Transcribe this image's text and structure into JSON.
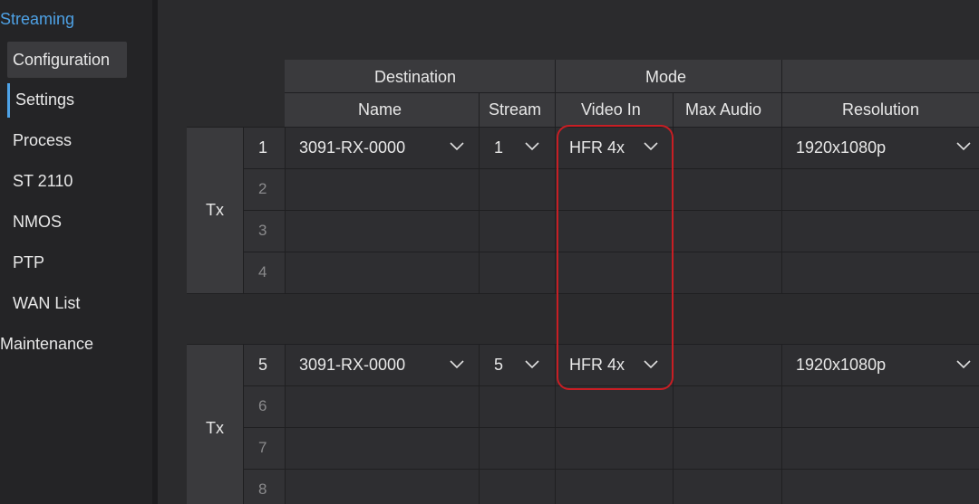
{
  "sidebar": {
    "streaming": "Streaming",
    "configuration": "Configuration",
    "settings": "Settings",
    "process": "Process",
    "st2110": "ST 2110",
    "nmos": "NMOS",
    "ptp": "PTP",
    "wan_list": "WAN List",
    "maintenance": "Maintenance"
  },
  "table": {
    "group_headers": {
      "destination": "Destination",
      "mode": "Mode"
    },
    "columns": {
      "name": "Name",
      "stream": "Stream",
      "video_in": "Video In",
      "max_audio": "Max Audio",
      "resolution": "Resolution"
    },
    "blocks": [
      {
        "label": "Tx",
        "rows": [
          {
            "index": "1",
            "name": "3091-RX-0000",
            "stream": "1",
            "video_in": "HFR 4x",
            "max_audio": "",
            "resolution": "1920x1080p"
          },
          {
            "index": "2"
          },
          {
            "index": "3"
          },
          {
            "index": "4"
          }
        ]
      },
      {
        "label": "Tx",
        "rows": [
          {
            "index": "5",
            "name": "3091-RX-0000",
            "stream": "5",
            "video_in": "HFR 4x",
            "max_audio": "",
            "resolution": "1920x1080p"
          },
          {
            "index": "6"
          },
          {
            "index": "7"
          },
          {
            "index": "8"
          }
        ]
      }
    ]
  },
  "colors": {
    "accent": "#4ea2e6",
    "highlight": "#c81e24"
  }
}
